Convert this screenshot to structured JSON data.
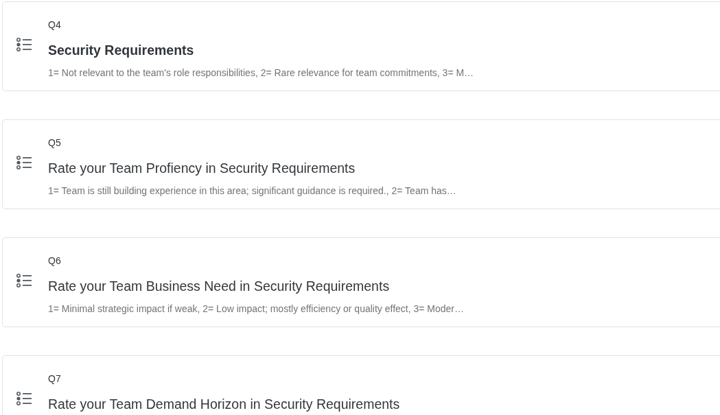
{
  "questions": [
    {
      "number": "Q4",
      "title": "Security Requirements",
      "bold": true,
      "description": "1= Not relevant to the team's role responsibilities, 2= Rare relevance for team commitments, 3= M…"
    },
    {
      "number": "Q5",
      "title": "Rate your Team Profiency in Security Requirements",
      "bold": false,
      "description": "1= Team is still building experience in this area; significant guidance is required., 2= Team has…"
    },
    {
      "number": "Q6",
      "title": "Rate your Team Business Need in Security Requirements",
      "bold": false,
      "description": "1= Minimal strategic impact if weak, 2= Low impact; mostly efficiency or quality effect, 3= Moder…"
    },
    {
      "number": "Q7",
      "title": "Rate your Team Demand Horizon in Security Requirements",
      "bold": false
    }
  ]
}
